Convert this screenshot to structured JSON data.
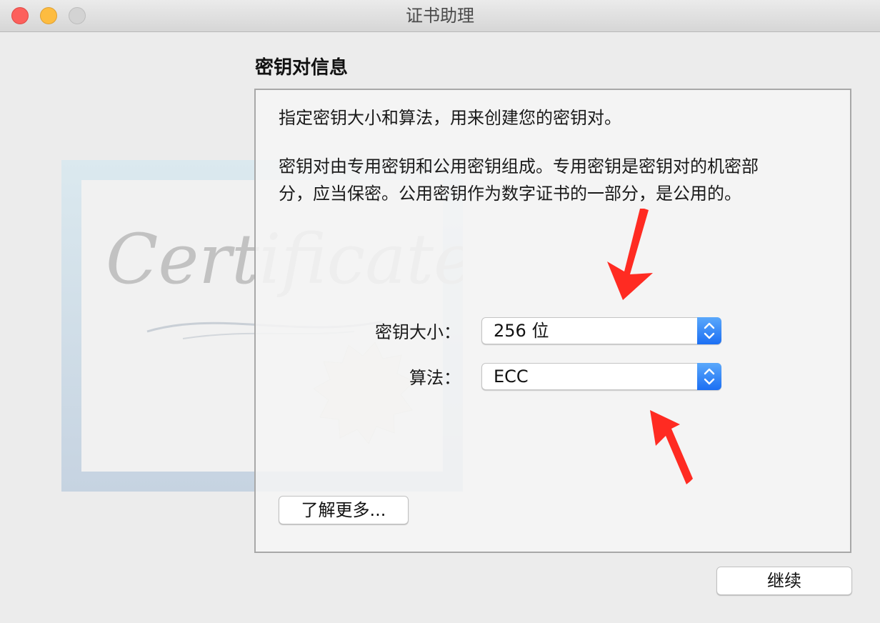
{
  "window": {
    "title": "证书助理"
  },
  "cert_art": {
    "text": "Certificate"
  },
  "section": {
    "title": "密钥对信息"
  },
  "panel": {
    "desc1": "指定密钥大小和算法，用来创建您的密钥对。",
    "desc2_line1": "密钥对由专用密钥和公用密钥组成。专用密钥是密钥对的机密部",
    "desc2_line2": "分，应当保密。公用密钥作为数字证书的一部分，是公用的。",
    "key_size": {
      "label": "密钥大小：",
      "value": "256 位"
    },
    "algorithm": {
      "label": "算法：",
      "value": "ECC"
    },
    "learn_more_label": "了解更多..."
  },
  "footer": {
    "continue_label": "继续"
  },
  "colors": {
    "accent": "#1c6ff3",
    "annotation_arrow": "#ff2b22"
  }
}
